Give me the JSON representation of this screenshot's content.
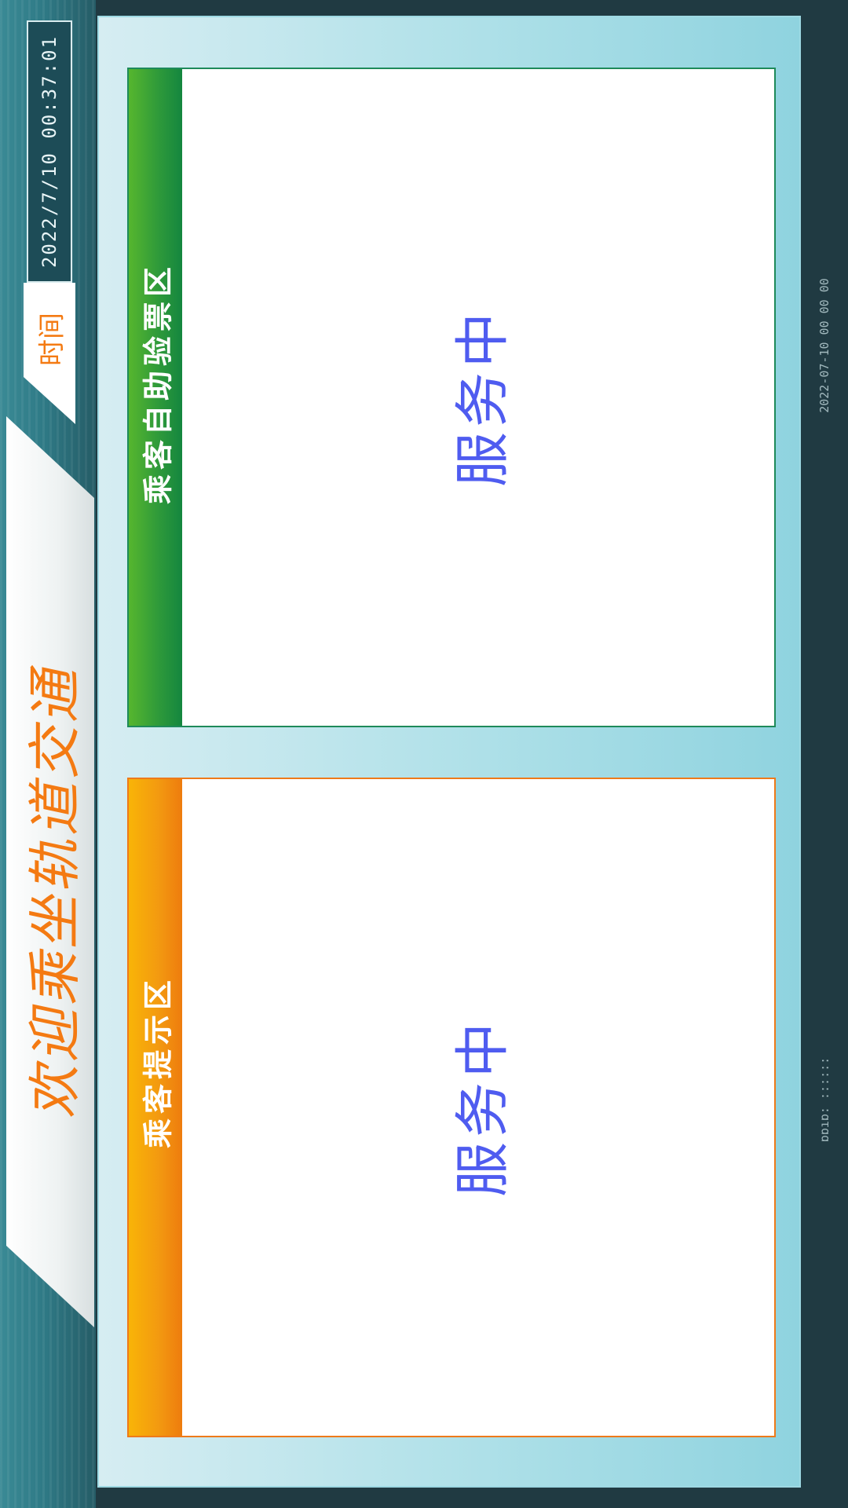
{
  "header": {
    "title": "欢迎乘坐轨道交通",
    "time_label": "时间",
    "datetime": "2022/7/10   00:37:01"
  },
  "panels": [
    {
      "title": "乘客自助验票区",
      "status": "服务中",
      "color": "#2f9a3a"
    },
    {
      "title": "乘客提示区",
      "status": "服务中",
      "color": "#f39a10"
    }
  ],
  "footer": {
    "left_text": "ɒɒıɒ: ::::::",
    "right_text": "2022-07-10 00 00 00"
  },
  "colors": {
    "title_orange": "#f47a12",
    "status_blue": "#4f5cf0",
    "background": "#203a42"
  }
}
